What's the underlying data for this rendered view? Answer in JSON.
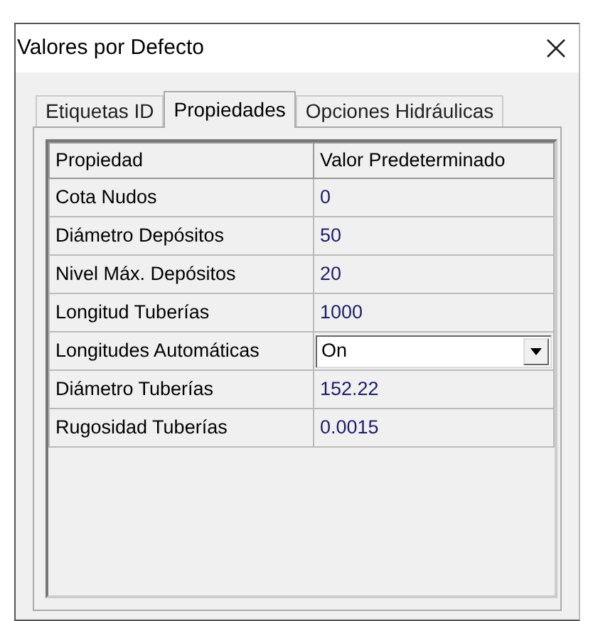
{
  "window": {
    "title": "Valores por Defecto"
  },
  "tabs": [
    {
      "label": "Etiquetas ID",
      "selected": false
    },
    {
      "label": "Propiedades",
      "selected": true
    },
    {
      "label": "Opciones Hidráulicas",
      "selected": false
    }
  ],
  "table": {
    "columns": [
      "Propiedad",
      "Valor Predeterminado"
    ],
    "rows": [
      {
        "kind": "text",
        "property": "Cota Nudos",
        "value": "0"
      },
      {
        "kind": "text",
        "property": "Diámetro Depósitos",
        "value": "50"
      },
      {
        "kind": "text",
        "property": "Nivel Máx. Depósitos",
        "value": "20"
      },
      {
        "kind": "text",
        "property": "Longitud Tuberías",
        "value": "1000"
      },
      {
        "kind": "dropdown",
        "property": "Longitudes Automáticas",
        "value": "On"
      },
      {
        "kind": "text",
        "property": "Diámetro Tuberías",
        "value": "152.22"
      },
      {
        "kind": "text",
        "property": "Rugosidad Tuberías",
        "value": "0.0015"
      }
    ]
  }
}
